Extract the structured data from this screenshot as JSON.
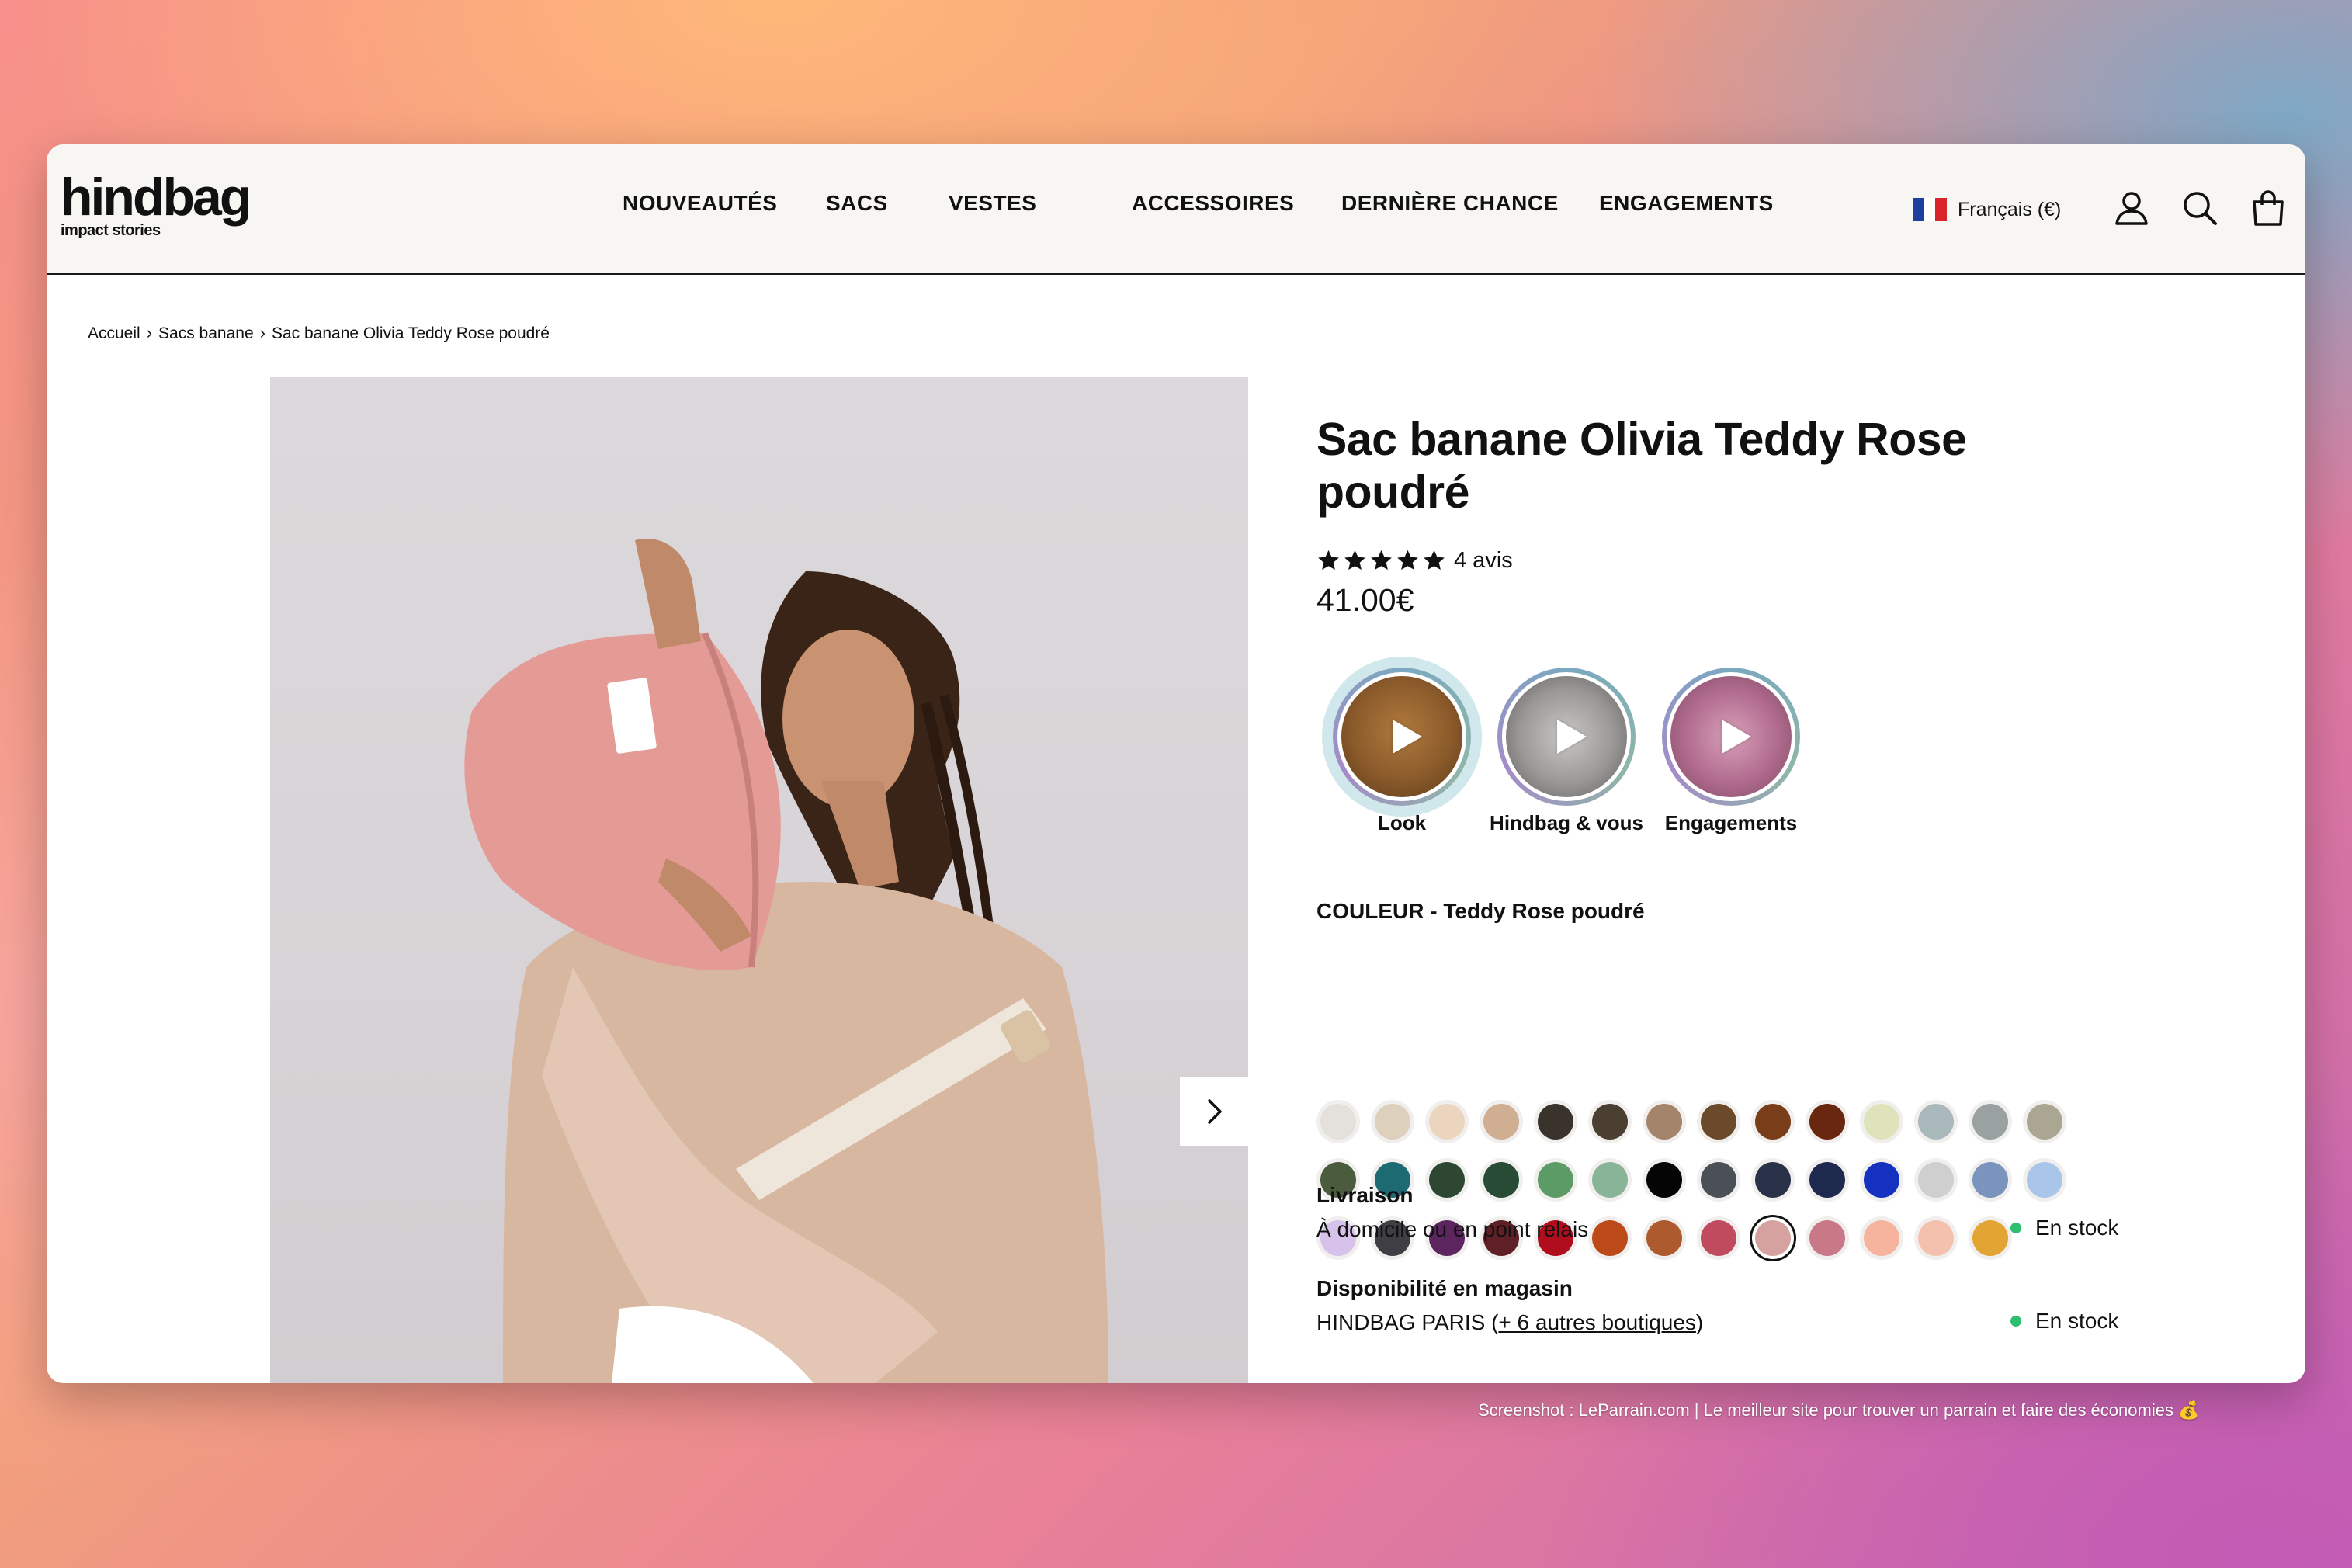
{
  "header": {
    "logo_main": "hindbag",
    "logo_sub": "impact stories",
    "nav": [
      "NOUVEAUTÉS",
      "SACS",
      "VESTES",
      "ACCESSOIRES",
      "DERNIÈRE CHANCE",
      "ENGAGEMENTS"
    ],
    "language": "Français (€)",
    "icons": [
      "account-icon",
      "search-icon",
      "cart-icon"
    ]
  },
  "breadcrumb": [
    "Accueil",
    "Sacs banane",
    "Sac banane Olivia Teddy Rose poudré"
  ],
  "product": {
    "title": "Sac banane Olivia Teddy Rose poudré",
    "rating": 5,
    "reviews": "4 avis",
    "price": "41.00€",
    "stories": [
      "Look",
      "Hindbag & vous",
      "Engagements"
    ],
    "color_label": "COULEUR - Teddy Rose poudré",
    "swatches": [
      [
        "#e4e1dc",
        "#ddd0bd",
        "#ebd5bf",
        "#cfae92",
        "#3a332c",
        "#4a3f30",
        "#a5846c",
        "#6b4a2c",
        "#7a3d1a",
        "#6a2710",
        "#dfe3bc",
        "#a9b8bb",
        "#9aa1a1",
        "#aaa692"
      ],
      [
        "#4a5c3d",
        "#1e6a72",
        "#2d4733",
        "#284b35",
        "#5c9b66",
        "#88b597",
        "#050505",
        "#4b4f57",
        "#2a3249",
        "#1d2a4e",
        "#1431bf",
        "#cfcfcf",
        "#7a94bd",
        "#a9c5ea"
      ],
      [
        "#d6c2ea",
        "#3e3e44",
        "#5c2560",
        "#5e1f26",
        "#b00e1c",
        "#bb4a18",
        "#ad5a2f",
        "#c04b5e",
        "#d6a2a0",
        "#c97888",
        "#f6b49e",
        "#f3c1ad",
        "#e2a534"
      ]
    ],
    "selected_swatch": [
      2,
      8
    ],
    "shipping_label": "Livraison",
    "shipping_text": "À domicile ou en point relais",
    "shipping_stock": "En stock",
    "store_label": "Disponibilité en magasin",
    "store_text_prefix": "HINDBAG PARIS (",
    "store_link": "+ 6 autres boutiques",
    "store_text_suffix": ")",
    "store_stock": "En stock"
  },
  "colors": {
    "header_bg": "#f8f6f2",
    "in_stock_dot": "#2fbf71",
    "text": "#111111"
  },
  "credit": "Screenshot : LeParrain.com | Le meilleur site pour trouver un parrain et faire des économies 💰"
}
